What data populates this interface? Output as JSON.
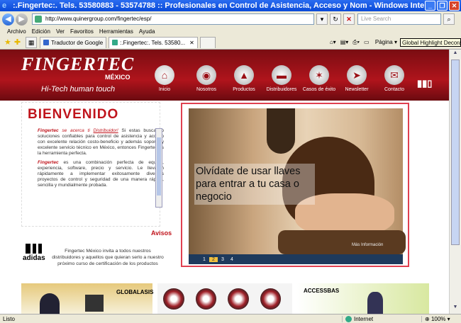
{
  "window": {
    "title": ":.Fingertec:. Tels. 53580883 - 53574788 :: Profesionales en Control de Asistencia, Acceso y Nom - Windows Internet Explorer",
    "minimize": "_",
    "maximize": "❐",
    "close": "✕"
  },
  "address": {
    "url": "http://www.quinergroup.com/fingertec/esp/",
    "search_placeholder": "Live Search"
  },
  "menu": [
    "Archivo",
    "Edición",
    "Ver",
    "Favoritos",
    "Herramientas",
    "Ayuda"
  ],
  "tabs": [
    {
      "label": "Traductor de Google"
    },
    {
      "label": ":.Fingertec:. Tels. 53580..."
    }
  ],
  "tools": {
    "pagina": "Página",
    "tooltip": "Global Highlight Decoration"
  },
  "site": {
    "logo": "FINGERTEC",
    "country": "MÉXICO",
    "tagline": "Hi-Tech human touch",
    "nav": [
      {
        "label": "Inicio",
        "icon": "home-icon"
      },
      {
        "label": "Nosotros",
        "icon": "fingerprint-icon"
      },
      {
        "label": "Productos",
        "icon": "device-icon"
      },
      {
        "label": "Distribuidores",
        "icon": "truck-icon"
      },
      {
        "label": "Casos de éxito",
        "icon": "stars-icon"
      },
      {
        "label": "Newsletter",
        "icon": "paper-plane-icon"
      },
      {
        "label": "Contacto",
        "icon": "envelope-icon"
      }
    ],
    "welcome": {
      "title": "BIENVENIDO",
      "p1_brand": "Fingertec",
      "p1_lead": " se acerca ti ",
      "p1_link": "Distribuidor!",
      "p1_rest": " Si estas buscando soluciones confiables para control de asistencia y acceso con excelente relación costo-beneficio y además soporte y excelente servicio técnico en México, entonces Fingertec es la herramienta perfecta.",
      "p2_brand": "Fingertec",
      "p2_rest": " es una combinación perfecta de equipo, experiencia, software, precio y servicio. Le llevarán rápidamente a implementar exitosamente diversos proyectos de control y seguridad de una manera rápida, sencilla y mundialmente probada."
    },
    "avisos": "Avisos",
    "adidas": "adidas",
    "invite": "Fingertec México invita a todos nuestros distribuidores y aquellos que quieran serlo a nuestro próximo curso de certificación de los productos",
    "banner": {
      "caption": "Olvídate de usar llaves para entrar a tu casa o negocio",
      "watermark": "Más Información",
      "pages": [
        "1",
        "2",
        "3",
        "4"
      ],
      "active_page": "2"
    },
    "bottom": {
      "glob_title": "GLOBALASIS",
      "acc_title": "ACCESSBAS"
    }
  },
  "status": {
    "text": "Listo",
    "zone": "Internet",
    "zoom": "100%"
  }
}
